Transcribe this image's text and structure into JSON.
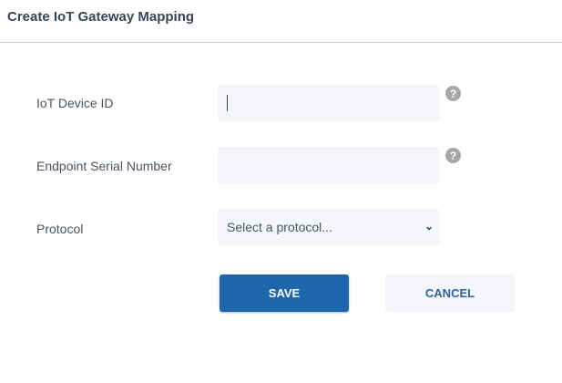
{
  "dialog": {
    "title": "Create IoT Gateway Mapping"
  },
  "form": {
    "device_id": {
      "label": "IoT Device ID",
      "value": ""
    },
    "serial": {
      "label": "Endpoint Serial Number",
      "value": ""
    },
    "protocol": {
      "label": "Protocol",
      "selected": "Select a protocol..."
    },
    "help_glyph": "?"
  },
  "actions": {
    "save": "SAVE",
    "cancel": "CANCEL"
  }
}
